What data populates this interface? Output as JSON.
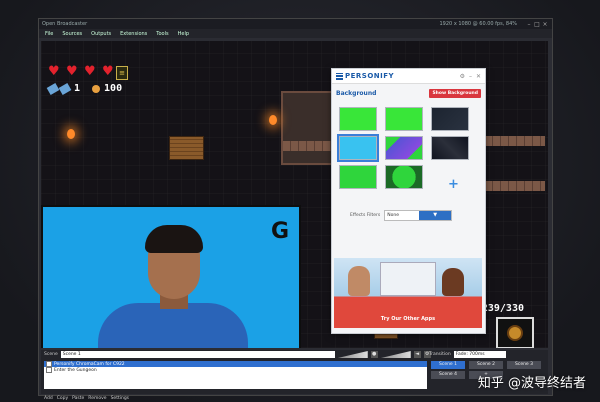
{
  "window": {
    "title": "Open Broadcaster",
    "stats": "1920 x 1080 @ 60.00 fps, 84%"
  },
  "menu": [
    "File",
    "Sources",
    "Outputs",
    "Extensions",
    "Tools",
    "Help"
  ],
  "hud": {
    "keys": "1",
    "coins": "100",
    "ammo": "239/330",
    "hearts": 4
  },
  "camera": {
    "logo": "G"
  },
  "personify": {
    "brand": "PERSONIFY",
    "header_icons": [
      "gear-icon",
      "minimize-icon",
      "close-icon"
    ],
    "bg_title": "Background",
    "show_btn": "Show Background",
    "add": "+",
    "effects_label": "Effects Filters",
    "effects_value": "None",
    "ad_text": "Try Our Other Apps",
    "thumb_colors": [
      "#39e639",
      "#39e639",
      "#1c2430",
      "#39c2f0",
      "#5a53d6",
      "#101420",
      "#2fd53c",
      "#2fd53c"
    ]
  },
  "controls": {
    "scene_label": "Scene",
    "scene_name": "Scene 1",
    "sources": [
      {
        "label": "Personify ChromaCam for C922",
        "selected": true
      },
      {
        "label": "Enter the Gungeon",
        "selected": false
      }
    ],
    "buttons": [
      "Add",
      "Copy",
      "Paste",
      "Remove",
      "Settings"
    ],
    "transition_label": "Transition",
    "transition_value": "Fade: 700ms",
    "scenes": [
      "Scene 1",
      "Scene 2",
      "Scene 3",
      "Scene 4",
      "+"
    ]
  },
  "watermark": "知乎 @波导终结者"
}
